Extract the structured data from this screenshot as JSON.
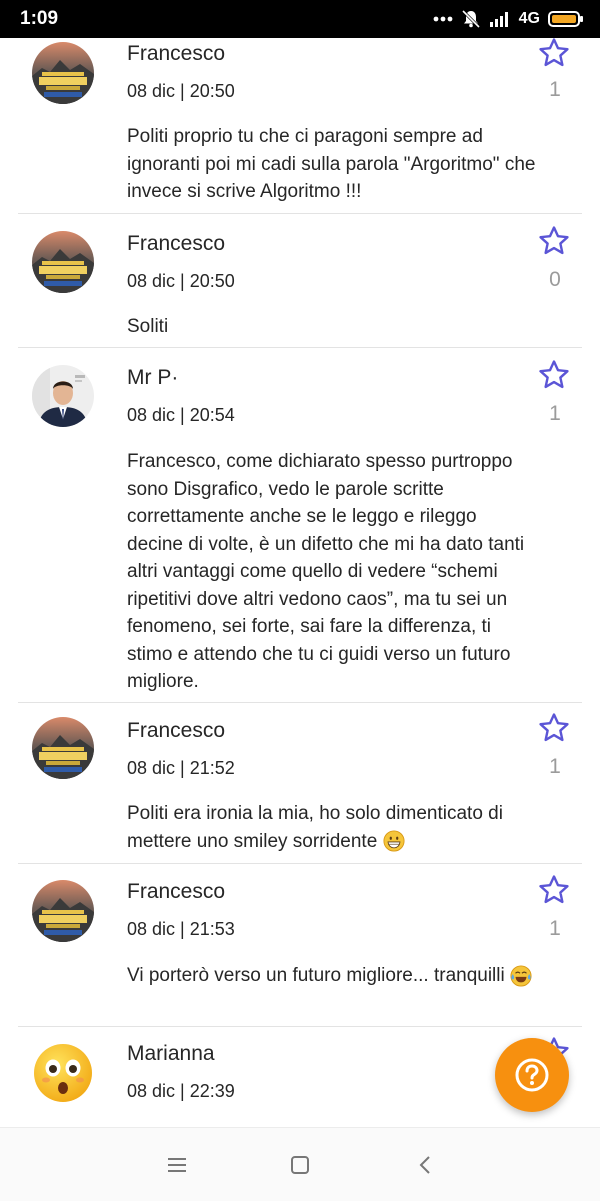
{
  "status_bar": {
    "time": "1:09",
    "network": "4G",
    "icons": [
      "more-dots-icon",
      "muted-bell-icon",
      "signal-icon",
      "battery-icon"
    ]
  },
  "comments": [
    {
      "author": "Francesco",
      "avatar": "pubg-avatar",
      "date": "08 dic | 20:50",
      "text": "Politi proprio tu che ci paragoni sempre ad ignoranti poi mi cadi sulla parola \"Argoritmo\" che invece si scrive Algoritmo !!!",
      "likes": "1"
    },
    {
      "author": "Francesco",
      "avatar": "pubg-avatar",
      "date": "08 dic | 20:50",
      "text": "Soliti",
      "likes": "0"
    },
    {
      "author": "Mr P·",
      "avatar": "person-avatar",
      "date": "08 dic | 20:54",
      "text": "Francesco, come dichiarato spesso purtroppo sono Disgrafico, vedo le parole scritte correttamente anche se le leggo e rileggo decine di volte, è un difetto che mi ha dato tanti altri vantaggi come quello di vedere “schemi ripetitivi dove altri vedono caos”, ma tu sei un fenomeno, sei forte, sai fare la differenza, ti stimo e attendo che tu ci guidi verso un futuro migliore.",
      "likes": "1"
    },
    {
      "author": "Francesco",
      "avatar": "pubg-avatar",
      "date": "08 dic | 21:52",
      "text": "Politi era ironia la mia, ho solo dimenticato di mettere uno smiley sorridente",
      "emoji": "grinning-face-emoji",
      "likes": "1"
    },
    {
      "author": "Francesco",
      "avatar": "pubg-avatar",
      "date": "08 dic | 21:53",
      "text": "Vi porterò verso un futuro migliore... tranquilli",
      "emoji": "tears-of-joy-emoji",
      "likes": "1"
    },
    {
      "author": "Marianna",
      "avatar": "surprised-emoji-avatar",
      "date": "08 dic | 22:39",
      "text": "",
      "likes": ""
    }
  ],
  "colors": {
    "star": "#5b55d6",
    "fab": "#f7900f",
    "count": "#9b9b9b",
    "divider": "#e3e3e3"
  },
  "nav": [
    "menu-icon",
    "home-icon",
    "back-icon"
  ]
}
